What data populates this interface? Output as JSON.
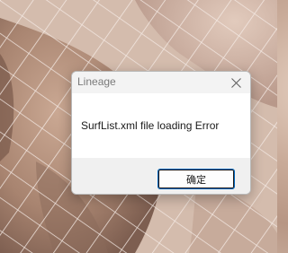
{
  "dialog": {
    "title": "Lineage",
    "message": "SurfList.xml file loading Error",
    "ok_label": "确定",
    "close_icon": "close-icon"
  },
  "colors": {
    "title_bar_bg": "#f3f3f3",
    "footer_bg": "#f0f0f0",
    "button_focus_border": "#0067c0"
  }
}
